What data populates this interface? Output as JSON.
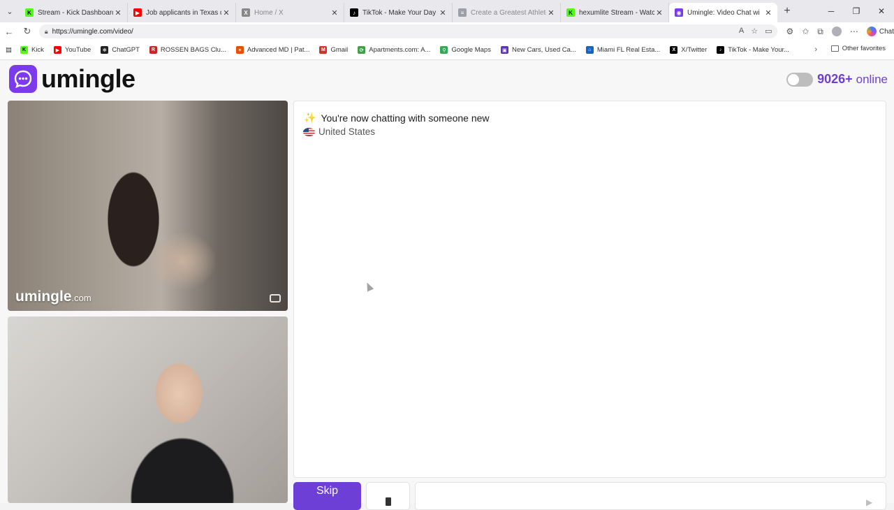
{
  "browser": {
    "tabs": [
      {
        "title": "Stream - Kick Dashboard",
        "favicon": "kick-icon",
        "color": "#53fc18",
        "active": false
      },
      {
        "title": "Job applicants in Texas questi",
        "favicon": "youtube-icon",
        "color": "#ff0000",
        "active": false
      },
      {
        "title": "Home / X",
        "favicon": "x-icon",
        "color": "#888888",
        "active": false
      },
      {
        "title": "TikTok - Make Your Day",
        "favicon": "tiktok-icon",
        "color": "#000000",
        "active": false
      },
      {
        "title": "Create a Greatest Athletes",
        "favicon": "doc-icon",
        "color": "#9aa0a6",
        "active": false
      },
      {
        "title": "hexumlite Stream - Watch Li",
        "favicon": "kick-icon",
        "color": "#53fc18",
        "active": false
      },
      {
        "title": "Umingle: Video Chat wi",
        "favicon": "umingle-icon",
        "color": "#7c3aed",
        "active": true
      }
    ],
    "url": "https://umingle.com/video/",
    "copilot_label": "Chat",
    "bookmarks": [
      {
        "label": "Kick",
        "icon": "kick-icon",
        "color": "#53fc18"
      },
      {
        "label": "YouTube",
        "icon": "youtube-icon",
        "color": "#ff0000"
      },
      {
        "label": "ChatGPT",
        "icon": "chatgpt-icon",
        "color": "#222222"
      },
      {
        "label": "ROSSEN BAGS Clu...",
        "icon": "rossen-icon",
        "color": "#c62828"
      },
      {
        "label": "Advanced MD | Pat...",
        "icon": "advancedmd-icon",
        "color": "#e65100"
      },
      {
        "label": "Gmail",
        "icon": "gmail-icon",
        "color": "#d93025"
      },
      {
        "label": "Apartments.com: A...",
        "icon": "apartments-icon",
        "color": "#43a047"
      },
      {
        "label": "Google Maps",
        "icon": "maps-icon",
        "color": "#34a853"
      },
      {
        "label": "New Cars, Used Ca...",
        "icon": "cars-icon",
        "color": "#5e35b1"
      },
      {
        "label": "Miami FL Real Esta...",
        "icon": "realestate-icon",
        "color": "#1565c0"
      },
      {
        "label": "X/Twitter",
        "icon": "x-icon",
        "color": "#000000"
      },
      {
        "label": "TikTok - Make Your...",
        "icon": "tiktok-icon",
        "color": "#000000"
      }
    ],
    "other_favorites": "Other favorites"
  },
  "page": {
    "brand": "umingle",
    "online_count": "9026+",
    "online_label": "online",
    "watermark_brand": "umingle",
    "watermark_domain": ".com",
    "system_message": "You're now chatting with someone new",
    "country": "United States",
    "skip_label": "Skip",
    "accent_color": "#6d3fd6"
  }
}
